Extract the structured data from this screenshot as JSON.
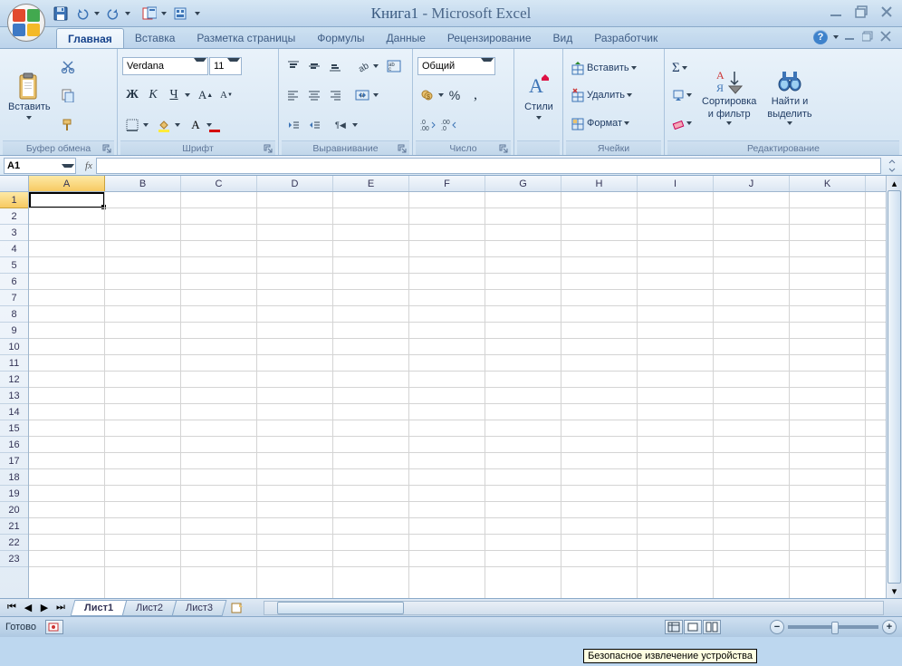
{
  "title": {
    "doc": "Книга1",
    "app": "Microsoft Excel"
  },
  "tabs": {
    "items": [
      "Главная",
      "Вставка",
      "Разметка страницы",
      "Формулы",
      "Данные",
      "Рецензирование",
      "Вид",
      "Разработчик"
    ],
    "active_index": 0
  },
  "ribbon": {
    "clipboard": {
      "label": "Буфер обмена",
      "paste": "Вставить"
    },
    "font": {
      "label": "Шрифт",
      "family": "Verdana",
      "size": "11",
      "bold": "Ж",
      "italic": "К",
      "underline": "Ч"
    },
    "alignment": {
      "label": "Выравнивание"
    },
    "number": {
      "label": "Число",
      "format": "Общий"
    },
    "styles": {
      "label": "Стили"
    },
    "cells": {
      "label": "Ячейки",
      "insert": "Вставить",
      "delete": "Удалить",
      "format": "Формат"
    },
    "editing": {
      "label": "Редактирование",
      "sort": "Сортировка\nи фильтр",
      "find": "Найти и\nвыделить"
    }
  },
  "formula_bar": {
    "name_box": "A1",
    "fx": "fx",
    "value": ""
  },
  "grid": {
    "columns": [
      "A",
      "B",
      "C",
      "D",
      "E",
      "F",
      "G",
      "H",
      "I",
      "J",
      "K"
    ],
    "rows": [
      1,
      2,
      3,
      4,
      5,
      6,
      7,
      8,
      9,
      10,
      11,
      12,
      13,
      14,
      15,
      16,
      17,
      18,
      19,
      20,
      21,
      22,
      23
    ],
    "active_col": "A",
    "active_row": 1
  },
  "sheets": {
    "items": [
      "Лист1",
      "Лист2",
      "Лист3"
    ],
    "active_index": 0
  },
  "status": {
    "ready": "Готово",
    "tooltip": "Безопасное извлечение устройства"
  }
}
